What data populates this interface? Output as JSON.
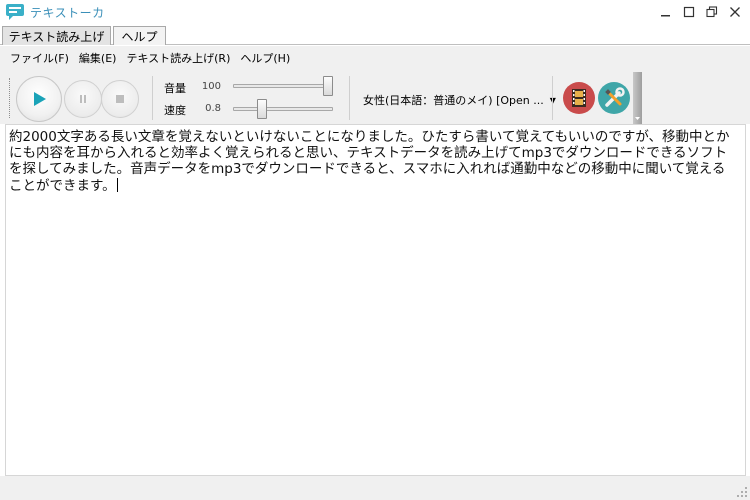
{
  "window": {
    "title": "テキストーカ",
    "buttons": [
      "minimize",
      "maximize",
      "restore",
      "close"
    ]
  },
  "tabs": [
    {
      "label": "テキスト読み上げ",
      "active": true
    },
    {
      "label": "ヘルプ",
      "active": false
    }
  ],
  "menu": [
    {
      "label": "ファイル(F)"
    },
    {
      "label": "編集(E)"
    },
    {
      "label": "テキスト読み上げ(R)"
    },
    {
      "label": "ヘルプ(H)"
    }
  ],
  "toolbar": {
    "play_icon": "play-icon",
    "pause_icon": "pause-icon",
    "stop_icon": "stop-icon",
    "volume_label": "音量",
    "volume_value": "100",
    "volume_level": 1.0,
    "speed_label": "速度",
    "speed_value": "0.8",
    "speed_level": 0.27,
    "voice_select": "女性(日本語：普通のメイ) [Open ...",
    "accent_play": "#1aa3b8",
    "movie_color": "#c94b4b",
    "settings_color": "#3fa6a8"
  },
  "editor": {
    "text": "約2000文字ある長い文章を覚えないといけないことになりました。ひたすら書いて覚えてもいいのですが、移動中とかにも内容を耳から入れると効率よく覚えられると思い、テキストデータを読み上げてmp3でダウンロードできるソフトを探してみました。音声データをmp3でダウンロードできると、スマホに入れれば通勤中などの移動中に聞いて覚えることができます。"
  }
}
